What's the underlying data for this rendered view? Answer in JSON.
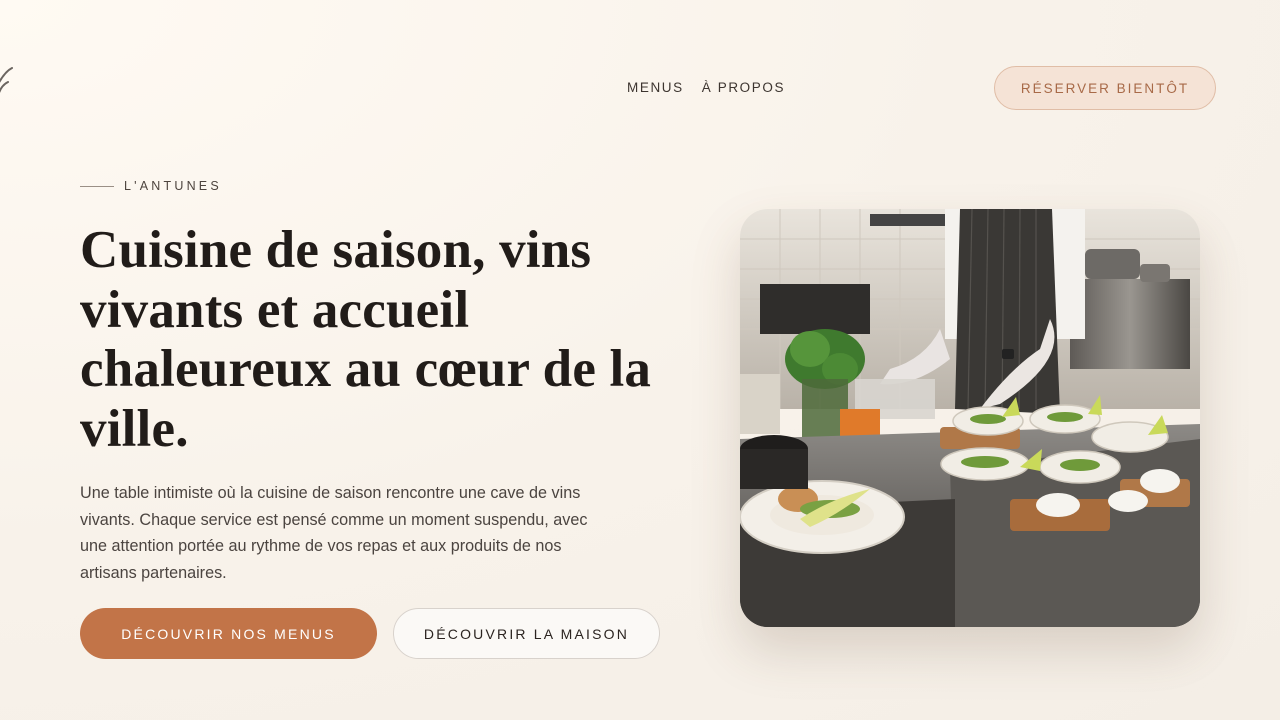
{
  "nav": {
    "items": [
      {
        "label": "MENUS"
      },
      {
        "label": "À PROPOS"
      }
    ],
    "reserve_label": "RÉSERVER BIENTÔT"
  },
  "hero": {
    "eyebrow": "L'ANTUNES",
    "title": "Cuisine de saison, vins vivants et accueil chaleureux au cœur de la ville.",
    "intro": "Une table intimiste où la cuisine de saison rencontre une cave de vins vivants. Chaque service est pensé comme un moment suspendu, avec une attention portée au rythme de vos repas et aux produits de nos artisans partenaires.",
    "primary_cta": "DÉCOUVRIR NOS MENUS",
    "secondary_cta": "DÉCOUVRIR LA MAISON"
  },
  "colors": {
    "accent": "#c27448",
    "accent_soft": "#f5e3d6",
    "text": "#211c19",
    "background": "#f8f2ea"
  },
  "icons": {
    "logo": "logo-mark-icon"
  }
}
